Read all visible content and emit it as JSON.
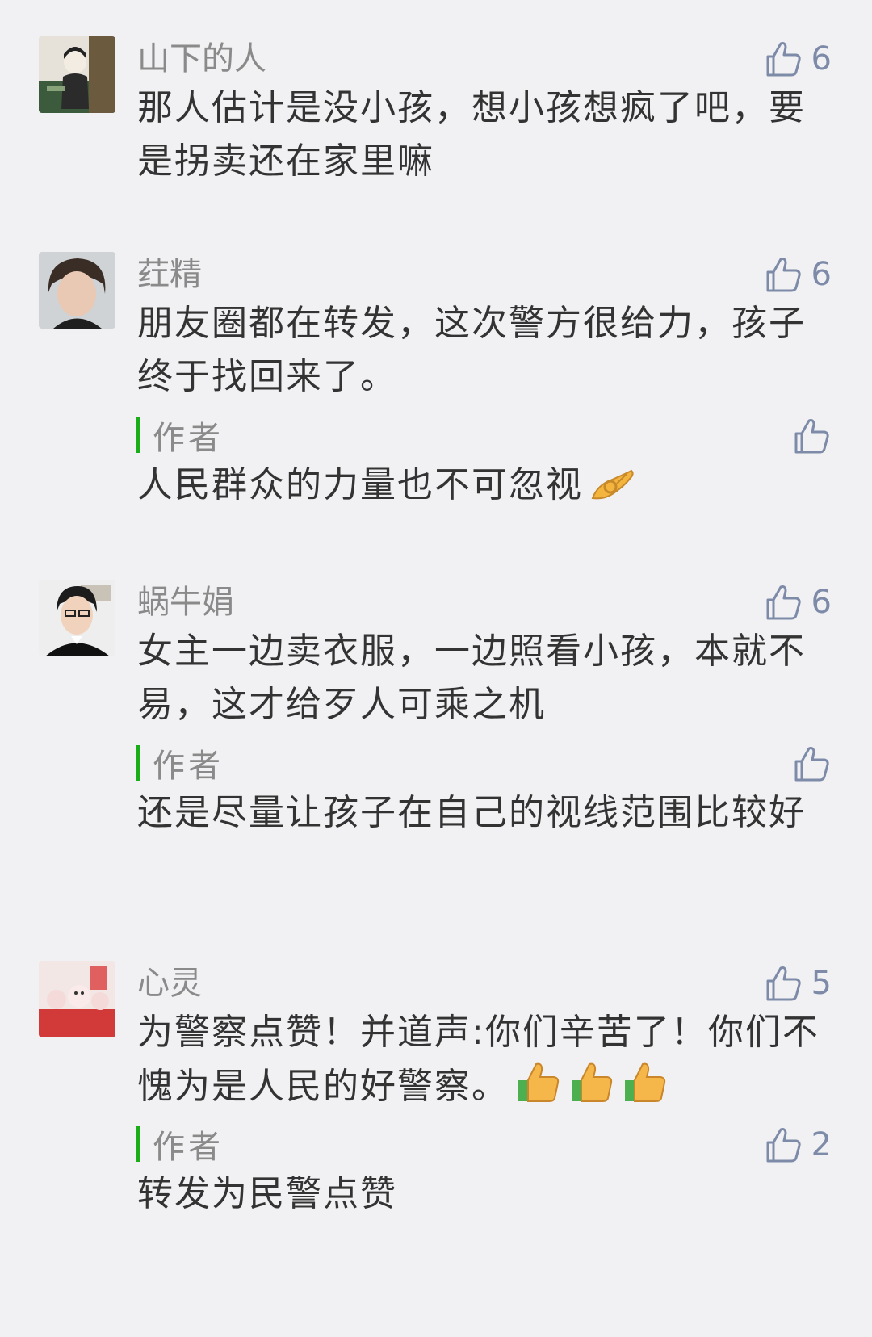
{
  "comments": [
    {
      "nickname": "山下的人",
      "likes": "6",
      "text": "那人估计是没小孩，想小孩想疯了吧，要是拐卖还在家里嘛",
      "avatar_icon": "avatar-illustration",
      "reply": null
    },
    {
      "nickname": "荭精",
      "likes": "6",
      "text": "朋友圈都在转发，这次警方很给力，孩子终于找回来了。",
      "avatar_icon": "avatar-photo",
      "reply": {
        "author_label": "作者",
        "likes": "",
        "text": "人民群众的力量也不可忽视",
        "emoji": "ok-hand-emoji"
      }
    },
    {
      "nickname": "蜗牛娟",
      "likes": "6",
      "text": "女主一边卖衣服，一边照看小孩，本就不易，这才给歹人可乘之机",
      "avatar_icon": "avatar-photo",
      "reply": {
        "author_label": "作者",
        "likes": "",
        "text": "还是尽量让孩子在自己的视线范围比较好"
      }
    },
    {
      "nickname": "心灵",
      "likes": "5",
      "text": "为警察点赞！并道声:你们辛苦了！你们不愧为是人民的好警察。",
      "avatar_icon": "avatar-photo",
      "emoji": "thumbs-up-emoji",
      "emoji_count": 3,
      "reply": {
        "author_label": "作者",
        "likes": "2",
        "text": "转发为民警点赞"
      }
    }
  ],
  "colors": {
    "background": "#f1f1f3",
    "nickname": "#8a8a8a",
    "like_icon": "#7d8aa8",
    "author_bar": "#1aad19",
    "text": "#333333"
  }
}
